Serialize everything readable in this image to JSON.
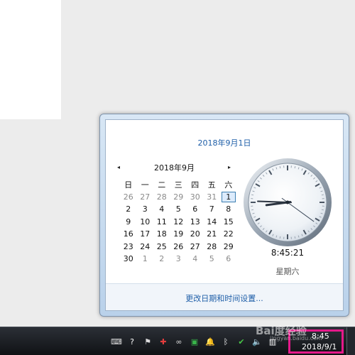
{
  "flyout": {
    "long_date": "2018年9月1日",
    "month_title": "2018年9月",
    "prev_icon": "◂",
    "next_icon": "▸",
    "weekdays": [
      "日",
      "一",
      "二",
      "三",
      "四",
      "五",
      "六"
    ],
    "weeks": [
      [
        "26",
        "27",
        "28",
        "29",
        "30",
        "31",
        "1"
      ],
      [
        "2",
        "3",
        "4",
        "5",
        "6",
        "7",
        "8"
      ],
      [
        "9",
        "10",
        "11",
        "12",
        "13",
        "14",
        "15"
      ],
      [
        "16",
        "17",
        "18",
        "19",
        "20",
        "21",
        "22"
      ],
      [
        "23",
        "24",
        "25",
        "26",
        "27",
        "28",
        "29"
      ],
      [
        "30",
        "1",
        "2",
        "3",
        "4",
        "5",
        "6"
      ]
    ],
    "selected_day": "1",
    "digital_time": "8:45:21",
    "weekday_label": "星期六",
    "settings_link": "更改日期和时间设置..."
  },
  "clock": {
    "hour": 8,
    "minute": 45,
    "second": 21
  },
  "taskbar": {
    "time": "8:45",
    "date": "2018/9/1",
    "watermark": "Bai度经验",
    "watermark_sub": "jingyan.baidu.com",
    "tray_icons": [
      {
        "name": "keyboard-icon",
        "glyph": "⌨",
        "color": "#dddddd"
      },
      {
        "name": "help-icon",
        "glyph": "?",
        "color": "#ffffff"
      },
      {
        "name": "flag-icon",
        "glyph": "⚑",
        "color": "#dddddd"
      },
      {
        "name": "app-icon",
        "glyph": "✚",
        "color": "#e43d3d"
      },
      {
        "name": "link-icon",
        "glyph": "∞",
        "color": "#dddddd"
      },
      {
        "name": "green-app-icon",
        "glyph": "▣",
        "color": "#39b54a"
      },
      {
        "name": "bell-icon",
        "glyph": "🔔",
        "color": "#f0f0f0"
      },
      {
        "name": "bluetooth-icon",
        "glyph": "ᛒ",
        "color": "#ffffff"
      },
      {
        "name": "security-icon",
        "glyph": "✔",
        "color": "#47c447"
      },
      {
        "name": "volume-icon",
        "glyph": "🔈",
        "color": "#ffffff"
      },
      {
        "name": "network-icon",
        "glyph": "▥",
        "color": "#ffffff"
      }
    ]
  },
  "colors": {
    "accent_link": "#1e5ea8",
    "highlight_border": "#e5198a"
  }
}
